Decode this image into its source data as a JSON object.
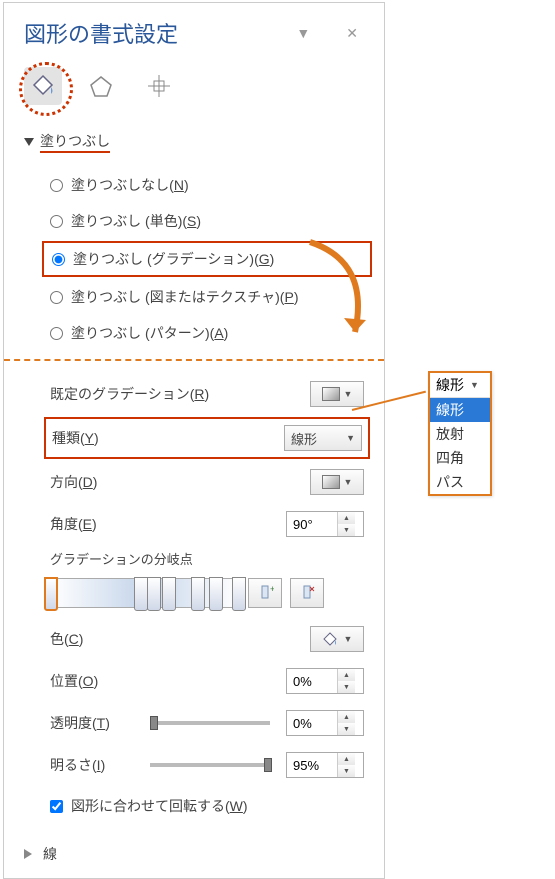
{
  "header": {
    "title": "図形の書式設定",
    "menu_glyph": "▼",
    "close_glyph": "✕"
  },
  "sections": {
    "fill": {
      "label": "塗りつぶし",
      "options": {
        "none": "塗りつぶしなし(N)",
        "solid": "塗りつぶし (単色)(S)",
        "gradient": "塗りつぶし (グラデーション)(G)",
        "picture": "塗りつぶし (図またはテクスチャ)(P)",
        "pattern": "塗りつぶし (パターン)(A)"
      }
    },
    "line": {
      "label": "線"
    }
  },
  "gradient": {
    "preset_label": "既定のグラデーション(R)",
    "type_label": "種類(Y)",
    "type_value": "線形",
    "direction_label": "方向(D)",
    "angle_label": "角度(E)",
    "angle_value": "90°",
    "stops_label": "グラデーションの分岐点",
    "color_label": "色(C)",
    "position_label": "位置(O)",
    "position_value": "0%",
    "transparency_label": "透明度(T)",
    "transparency_value": "0%",
    "brightness_label": "明るさ(I)",
    "brightness_value": "95%",
    "rotate_label": "図形に合わせて回転する(W)",
    "rotate_checked": true,
    "stops": [
      0,
      48,
      55,
      63,
      78,
      88,
      100
    ]
  },
  "type_dropdown": {
    "selected": "線形",
    "options": [
      "線形",
      "放射",
      "四角",
      "パス"
    ]
  }
}
